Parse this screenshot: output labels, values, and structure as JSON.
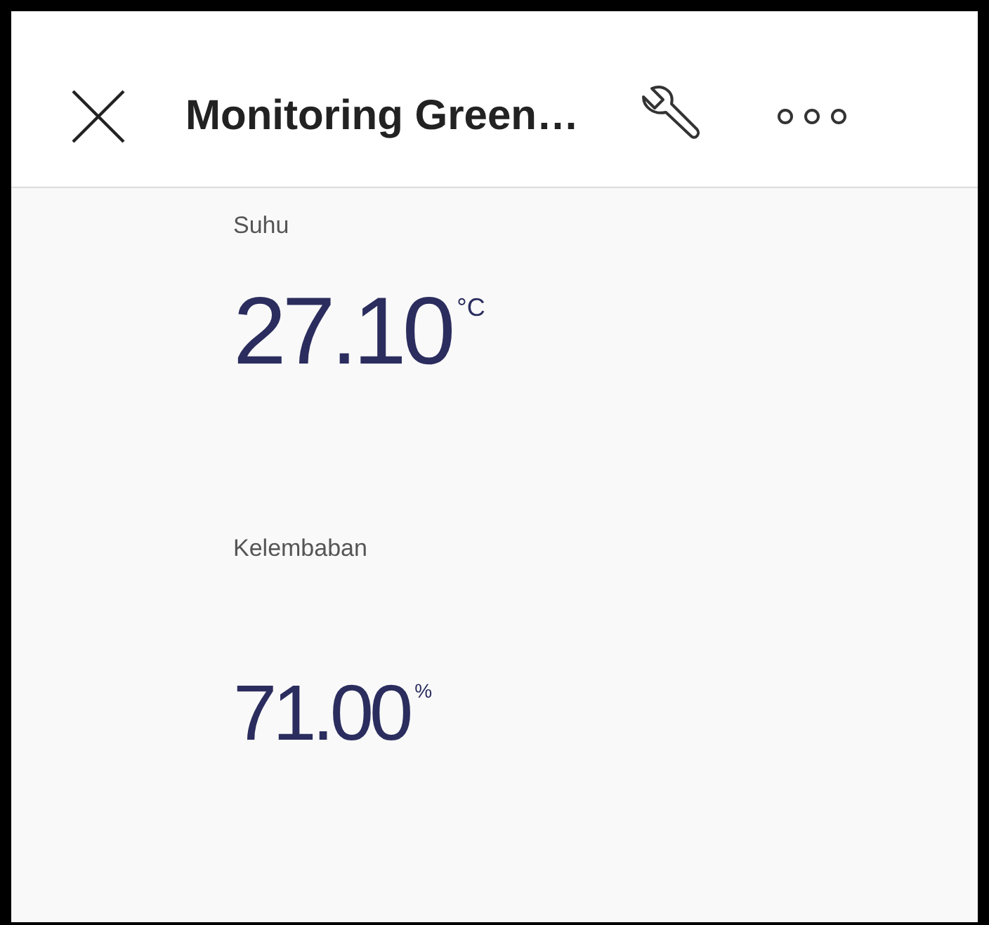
{
  "header": {
    "title": "Monitoring Green…"
  },
  "widgets": [
    {
      "label": "Suhu",
      "value": "27.10",
      "unit": "°C"
    },
    {
      "label": "Kelembaban",
      "value": "71.00",
      "unit": "%"
    }
  ]
}
